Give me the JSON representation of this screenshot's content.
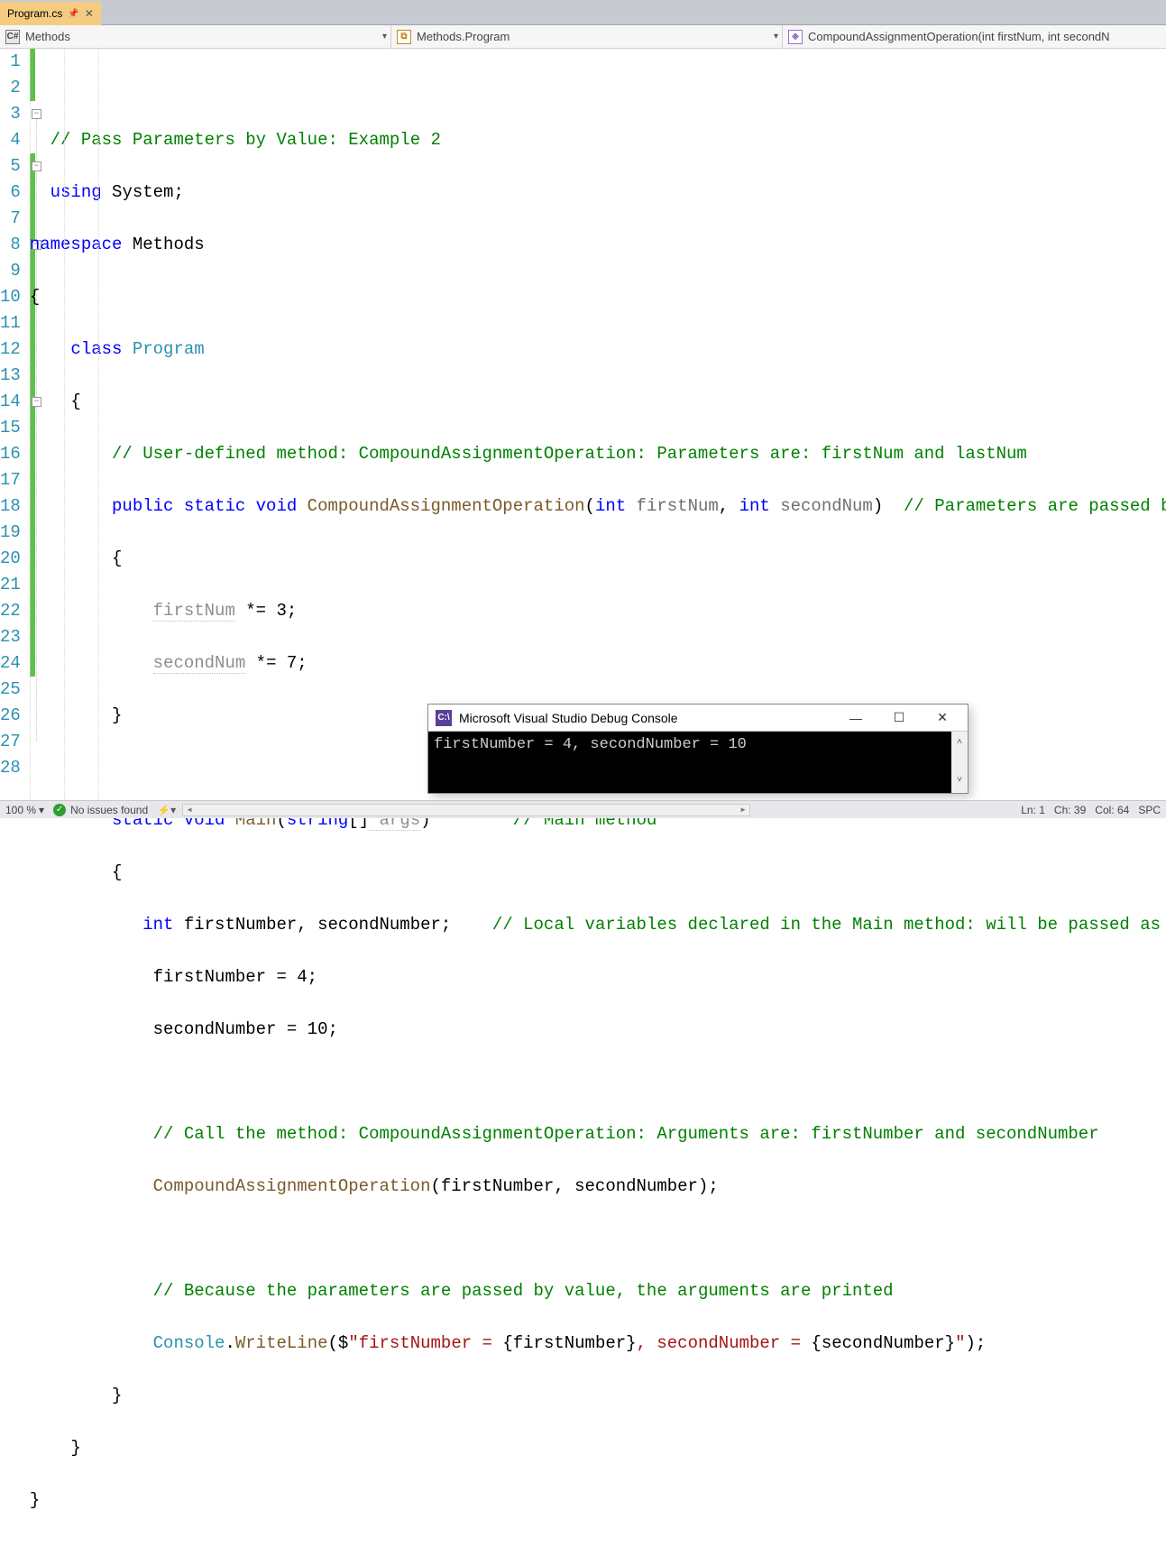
{
  "tab": {
    "filename": "Program.cs"
  },
  "nav": {
    "scope": "Methods",
    "class": "Methods.Program",
    "member": "CompoundAssignmentOperation(int firstNum, int secondN"
  },
  "code": {
    "lines": [
      "1",
      "2",
      "3",
      "4",
      "5",
      "6",
      "7",
      "8",
      "9",
      "10",
      "11",
      "12",
      "13",
      "14",
      "15",
      "16",
      "17",
      "18",
      "19",
      "20",
      "21",
      "22",
      "23",
      "24",
      "25",
      "26",
      "27",
      "28"
    ],
    "l1_comment": "// Pass Parameters by Value: Example 2",
    "l2_using": "using",
    "l2_sys": " System;",
    "l3_ns": "namespace",
    "l3_name": " Methods",
    "l5_class": "class",
    "l5_name": " Program",
    "l7_comment": "// User-defined method: CompoundAssignmentOperation: Parameters are: firstNum and lastNum",
    "l8_mods": "public static void",
    "l8_method": " CompoundAssignmentOperation",
    "l8_p1t": "int",
    "l8_p1n": " firstNum",
    "l8_p2t": "int",
    "l8_p2n": " secondNum",
    "l8_endcomment": "  // Parameters are passed by value",
    "l10_a": "firstNum",
    "l10_b": " *= 3;",
    "l11_a": "secondNum",
    "l11_b": " *= 7;",
    "l14_mods": "static void",
    "l14_method": " Main",
    "l14_pt": "string",
    "l14_br": "[]",
    "l14_pn": " args",
    "l14_cm": "        // Main method",
    "l16_t": "int",
    "l16_v": " firstNumber, secondNumber;",
    "l16_cm": "    // Local variables declared in the Main method: will be passed as arguments",
    "l17": "firstNumber = 4;",
    "l18": "secondNumber = 10;",
    "l20_cm": "// Call the method: CompoundAssignmentOperation: Arguments are: firstNumber and secondNumber",
    "l21_call": "CompoundAssignmentOperation",
    "l21_args": "(firstNumber, secondNumber);",
    "l23_cm": "// Because the parameters are passed by value, the arguments are printed",
    "l24_cons": "Console",
    "l24_dot": ".",
    "l24_wl": "WriteLine",
    "l24_open": "($",
    "l24_s1": "\"firstNumber = ",
    "l24_i1": "{firstNumber}",
    "l24_s2": ", secondNumber = ",
    "l24_i2": "{secondNumber}",
    "l24_s3": "\"",
    "l24_close": ");"
  },
  "console": {
    "title": "Microsoft Visual Studio Debug Console",
    "output": "firstNumber = 4, secondNumber = 10"
  },
  "status": {
    "zoom": "100 %",
    "health": "No issues found",
    "ln": "Ln: 1",
    "ch": "Ch: 39",
    "col": "Col: 64",
    "ins": "SPC"
  }
}
